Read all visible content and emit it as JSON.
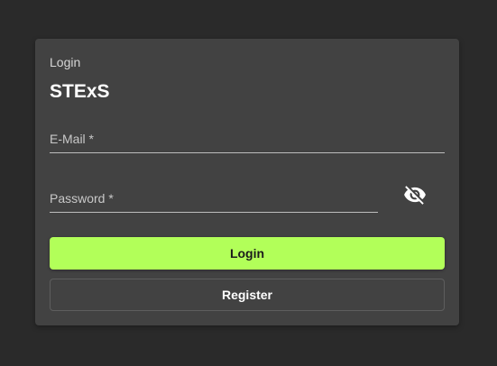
{
  "card": {
    "overline": "Login",
    "title": "STExS"
  },
  "form": {
    "email_label": "E-Mail *",
    "password_label": "Password *",
    "password_toggle_icon": "eye-off-icon"
  },
  "buttons": {
    "login_label": "Login",
    "register_label": "Register"
  },
  "colors": {
    "background": "#2a2a2a",
    "card": "#424242",
    "accent": "#b2ff59"
  }
}
